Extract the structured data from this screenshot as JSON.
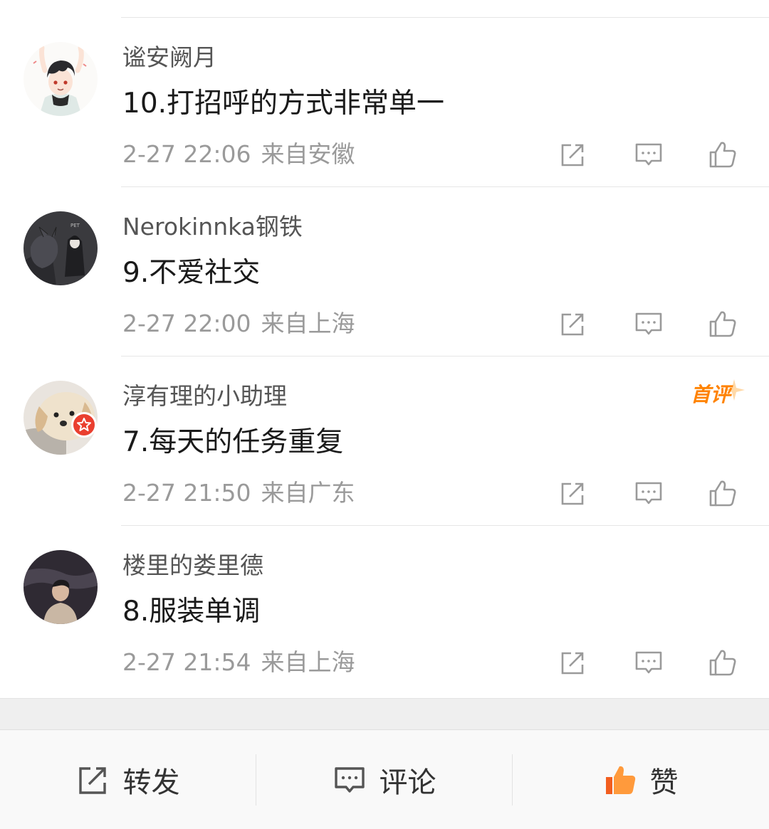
{
  "comments": [
    {
      "username": "谧安阙月",
      "text": "10.打招呼的方式非常单一",
      "time": "2-27 22:06",
      "location": "来自安徽",
      "avatar": "anime-boy-avatar",
      "first_comment": false,
      "verified": false
    },
    {
      "username": "Nerokinnka钢铁",
      "text": "9.不爱社交",
      "time": "2-27 22:00",
      "location": "来自上海",
      "avatar": "dark-creature-avatar",
      "first_comment": false,
      "verified": false
    },
    {
      "username": "淳有理的小助理",
      "text": "7.每天的任务重复",
      "time": "2-27 21:50",
      "location": "来自广东",
      "avatar": "dog-avatar",
      "first_comment": true,
      "first_comment_label": "首评",
      "verified": true
    },
    {
      "username": "楼里的娄里德",
      "text": "8.服装单调",
      "time": "2-27 21:54",
      "location": "来自上海",
      "avatar": "person-photo-avatar",
      "first_comment": false,
      "verified": false
    }
  ],
  "bottom_bar": {
    "share_label": "转发",
    "comment_label": "评论",
    "like_label": "赞"
  },
  "colors": {
    "accent": "#ff8200",
    "badge_red": "#ea3f2f",
    "icon_gray": "#9a9a9a",
    "text_secondary": "#555555"
  }
}
